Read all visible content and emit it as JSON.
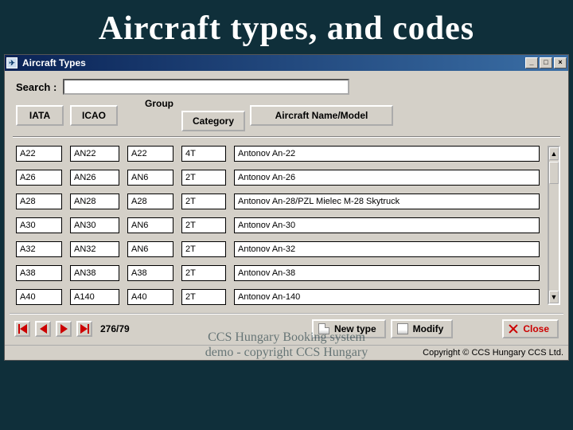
{
  "slide": {
    "title": "Aircraft types, and codes"
  },
  "window": {
    "title": "Aircraft Types",
    "app_icon_glyph": "✈",
    "buttons": {
      "min": "_",
      "max": "□",
      "close": "×"
    }
  },
  "search": {
    "label": "Search :",
    "value": ""
  },
  "headers": {
    "iata": "IATA",
    "icao": "ICAO",
    "group": "Group",
    "category": "Category",
    "name": "Aircraft Name/Model"
  },
  "rows": [
    {
      "iata": "A22",
      "icao": "AN22",
      "group": "A22",
      "cat": "4T",
      "name": "Antonov An-22"
    },
    {
      "iata": "A26",
      "icao": "AN26",
      "group": "AN6",
      "cat": "2T",
      "name": "Antonov An-26"
    },
    {
      "iata": "A28",
      "icao": "AN28",
      "group": "A28",
      "cat": "2T",
      "name": "Antonov An-28/PZL Mielec M-28 Skytruck"
    },
    {
      "iata": "A30",
      "icao": "AN30",
      "group": "AN6",
      "cat": "2T",
      "name": "Antonov An-30"
    },
    {
      "iata": "A32",
      "icao": "AN32",
      "group": "AN6",
      "cat": "2T",
      "name": "Antonov An-32"
    },
    {
      "iata": "A38",
      "icao": "AN38",
      "group": "A38",
      "cat": "2T",
      "name": "Antonov An-38"
    },
    {
      "iata": "A40",
      "icao": "A140",
      "group": "A40",
      "cat": "2T",
      "name": "Antonov An-140"
    }
  ],
  "pager": {
    "counter": "276/79"
  },
  "actions": {
    "new": "New type",
    "modify": "Modify",
    "close": "Close"
  },
  "copyright": "Copyright © CCS Hungary CCS Ltd.",
  "overlay": {
    "line1": "CCS Hungary Booking system",
    "line2": "demo - copyright CCS Hungary"
  }
}
